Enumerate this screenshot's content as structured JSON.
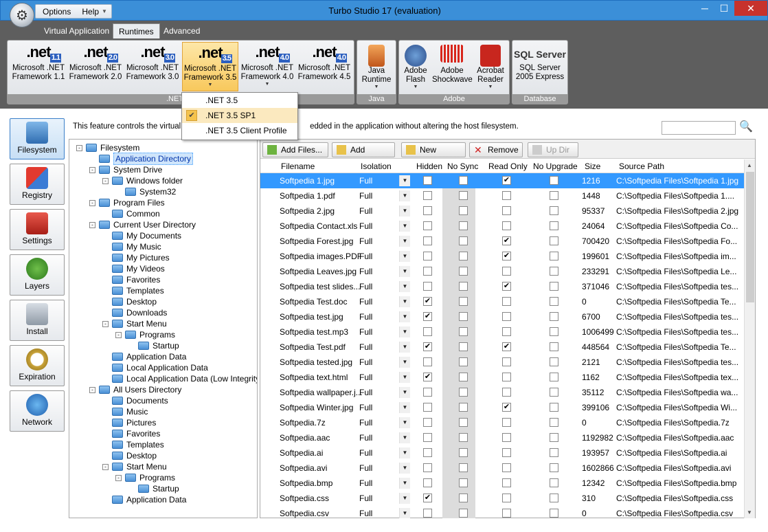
{
  "window": {
    "title": "Turbo Studio 17 (evaluation)"
  },
  "menu": {
    "options": "Options",
    "help": "Help"
  },
  "ribbon_tabs": [
    "Virtual Application",
    "Runtimes",
    "Advanced"
  ],
  "ribbon": {
    "net_buttons": [
      {
        "badge": "1.1",
        "label1": "Microsoft .NET",
        "label2": "Framework 1.1"
      },
      {
        "badge": "2.0",
        "label1": "Microsoft .NET",
        "label2": "Framework 2.0"
      },
      {
        "badge": "3.0",
        "label1": "Microsoft .NET",
        "label2": "Framework 3.0"
      },
      {
        "badge": "3.5",
        "label1": "Microsoft .NET",
        "label2": "Framework 3.5"
      },
      {
        "badge": "4.0",
        "label1": "Microsoft .NET",
        "label2": "Framework 4.0"
      },
      {
        "badge": "4.0",
        "label1": "Microsoft .NET",
        "label2": "Framework 4.5"
      }
    ],
    "net_group_label": ".NET Ru",
    "java": {
      "label1": "Java",
      "label2": "Runtime",
      "group": "Java"
    },
    "adobe": [
      {
        "label1": "Adobe",
        "label2": "Flash"
      },
      {
        "label1": "Adobe",
        "label2": "Shockwave"
      },
      {
        "label1": "Acrobat",
        "label2": "Reader"
      }
    ],
    "adobe_group": "Adobe",
    "sql": {
      "label1": "SQL Server",
      "label2": "2005 Express",
      "group": "Database",
      "logo": "SQL Server"
    }
  },
  "dropdown": [
    ".NET 3.5",
    ".NET 3.5 SP1",
    ".NET 3.5 Client Profile"
  ],
  "leftnav": [
    "Filesystem",
    "Registry",
    "Settings",
    "Layers",
    "Install",
    "Expiration",
    "Network"
  ],
  "description": {
    "left": "This feature controls the virtual file",
    "right": "edded in the application without altering the host filesystem."
  },
  "tree": [
    {
      "label": "Filesystem",
      "level": 0,
      "exp": "-"
    },
    {
      "label": "Application Directory",
      "level": 1,
      "exp": ""
    },
    {
      "label": "System Drive",
      "level": 1,
      "exp": "-"
    },
    {
      "label": "Windows folder",
      "level": 2,
      "exp": "-"
    },
    {
      "label": "System32",
      "level": 3,
      "exp": ""
    },
    {
      "label": "Program Files",
      "level": 1,
      "exp": "-"
    },
    {
      "label": "Common",
      "level": 2,
      "exp": ""
    },
    {
      "label": "Current User Directory",
      "level": 1,
      "exp": "-"
    },
    {
      "label": "My Documents",
      "level": 2,
      "exp": ""
    },
    {
      "label": "My Music",
      "level": 2,
      "exp": ""
    },
    {
      "label": "My Pictures",
      "level": 2,
      "exp": ""
    },
    {
      "label": "My Videos",
      "level": 2,
      "exp": ""
    },
    {
      "label": "Favorites",
      "level": 2,
      "exp": ""
    },
    {
      "label": "Templates",
      "level": 2,
      "exp": ""
    },
    {
      "label": "Desktop",
      "level": 2,
      "exp": ""
    },
    {
      "label": "Downloads",
      "level": 2,
      "exp": ""
    },
    {
      "label": "Start Menu",
      "level": 2,
      "exp": "-"
    },
    {
      "label": "Programs",
      "level": 3,
      "exp": "-"
    },
    {
      "label": "Startup",
      "level": 4,
      "exp": ""
    },
    {
      "label": "Application Data",
      "level": 2,
      "exp": ""
    },
    {
      "label": "Local Application Data",
      "level": 2,
      "exp": ""
    },
    {
      "label": "Local Application Data (Low Integrity)",
      "level": 2,
      "exp": ""
    },
    {
      "label": "All Users Directory",
      "level": 1,
      "exp": "-"
    },
    {
      "label": "Documents",
      "level": 2,
      "exp": ""
    },
    {
      "label": "Music",
      "level": 2,
      "exp": ""
    },
    {
      "label": "Pictures",
      "level": 2,
      "exp": ""
    },
    {
      "label": "Favorites",
      "level": 2,
      "exp": ""
    },
    {
      "label": "Templates",
      "level": 2,
      "exp": ""
    },
    {
      "label": "Desktop",
      "level": 2,
      "exp": ""
    },
    {
      "label": "Start Menu",
      "level": 2,
      "exp": "-"
    },
    {
      "label": "Programs",
      "level": 3,
      "exp": "-"
    },
    {
      "label": "Startup",
      "level": 4,
      "exp": ""
    },
    {
      "label": "Application Data",
      "level": 2,
      "exp": ""
    }
  ],
  "toolbar": {
    "add_files": "Add Files...",
    "add_folder": "Add Folder",
    "new_folder": "New Folder",
    "remove": "Remove",
    "up_dir": "Up Dir"
  },
  "columns": [
    "Filename",
    "Isolation",
    "Hidden",
    "No Sync",
    "Read Only",
    "No Upgrade",
    "Size",
    "Source Path"
  ],
  "rows": [
    {
      "name": "Softpedia 1.jpg",
      "iso": "Full",
      "hidden": false,
      "ro": true,
      "size": "1216",
      "path": "C:\\Softpedia Files\\Softpedia 1.jpg"
    },
    {
      "name": "Softpedia 1.pdf",
      "iso": "Full",
      "hidden": false,
      "ro": false,
      "size": "1448",
      "path": "C:\\Softpedia Files\\Softpedia 1...."
    },
    {
      "name": "Softpedia 2.jpg",
      "iso": "Full",
      "hidden": false,
      "ro": false,
      "size": "95337",
      "path": "C:\\Softpedia Files\\Softpedia 2.jpg"
    },
    {
      "name": "Softpedia Contact.xls",
      "iso": "Full",
      "hidden": false,
      "ro": false,
      "size": "24064",
      "path": "C:\\Softpedia Files\\Softpedia Co..."
    },
    {
      "name": "Softpedia Forest.jpg",
      "iso": "Full",
      "hidden": false,
      "ro": true,
      "size": "700420",
      "path": "C:\\Softpedia Files\\Softpedia Fo..."
    },
    {
      "name": "Softpedia images.PDF",
      "iso": "Full",
      "hidden": false,
      "ro": true,
      "size": "199601",
      "path": "C:\\Softpedia Files\\Softpedia im..."
    },
    {
      "name": "Softpedia Leaves.jpg",
      "iso": "Full",
      "hidden": false,
      "ro": false,
      "size": "233291",
      "path": "C:\\Softpedia Files\\Softpedia Le..."
    },
    {
      "name": "Softpedia test slides...",
      "iso": "Full",
      "hidden": false,
      "ro": true,
      "size": "371046",
      "path": "C:\\Softpedia Files\\Softpedia tes..."
    },
    {
      "name": "Softpedia Test.doc",
      "iso": "Full",
      "hidden": true,
      "ro": false,
      "size": "0",
      "path": "C:\\Softpedia Files\\Softpedia Te..."
    },
    {
      "name": "Softpedia test.jpg",
      "iso": "Full",
      "hidden": true,
      "ro": false,
      "size": "6700",
      "path": "C:\\Softpedia Files\\Softpedia tes..."
    },
    {
      "name": "Softpedia test.mp3",
      "iso": "Full",
      "hidden": false,
      "ro": false,
      "size": "1006499",
      "path": "C:\\Softpedia Files\\Softpedia tes..."
    },
    {
      "name": "Softpedia Test.pdf",
      "iso": "Full",
      "hidden": true,
      "ro": true,
      "size": "448564",
      "path": "C:\\Softpedia Files\\Softpedia Te..."
    },
    {
      "name": "Softpedia tested.jpg",
      "iso": "Full",
      "hidden": false,
      "ro": false,
      "size": "2121",
      "path": "C:\\Softpedia Files\\Softpedia tes..."
    },
    {
      "name": "Softpedia text.html",
      "iso": "Full",
      "hidden": true,
      "ro": false,
      "size": "1162",
      "path": "C:\\Softpedia Files\\Softpedia tex..."
    },
    {
      "name": "Softpedia wallpaper.j...",
      "iso": "Full",
      "hidden": false,
      "ro": false,
      "size": "35112",
      "path": "C:\\Softpedia Files\\Softpedia wa..."
    },
    {
      "name": "Softpedia Winter.jpg",
      "iso": "Full",
      "hidden": false,
      "ro": true,
      "size": "399106",
      "path": "C:\\Softpedia Files\\Softpedia Wi..."
    },
    {
      "name": "Softpedia.7z",
      "iso": "Full",
      "hidden": false,
      "ro": false,
      "size": "0",
      "path": "C:\\Softpedia Files\\Softpedia.7z"
    },
    {
      "name": "Softpedia.aac",
      "iso": "Full",
      "hidden": false,
      "ro": false,
      "size": "1192982",
      "path": "C:\\Softpedia Files\\Softpedia.aac"
    },
    {
      "name": "Softpedia.ai",
      "iso": "Full",
      "hidden": false,
      "ro": false,
      "size": "193957",
      "path": "C:\\Softpedia Files\\Softpedia.ai"
    },
    {
      "name": "Softpedia.avi",
      "iso": "Full",
      "hidden": false,
      "ro": false,
      "size": "1602866",
      "path": "C:\\Softpedia Files\\Softpedia.avi"
    },
    {
      "name": "Softpedia.bmp",
      "iso": "Full",
      "hidden": false,
      "ro": false,
      "size": "12342",
      "path": "C:\\Softpedia Files\\Softpedia.bmp"
    },
    {
      "name": "Softpedia.css",
      "iso": "Full",
      "hidden": true,
      "ro": false,
      "size": "310",
      "path": "C:\\Softpedia Files\\Softpedia.css"
    },
    {
      "name": "Softpedia.csv",
      "iso": "Full",
      "hidden": false,
      "ro": false,
      "size": "0",
      "path": "C:\\Softpedia Files\\Softpedia.csv"
    }
  ],
  "colors": {
    "title_bar": "#3b8fd8",
    "selection": "#3399ff",
    "ribbon_bg": "#5e5e5e",
    "selected_button": "#f8c85c"
  }
}
